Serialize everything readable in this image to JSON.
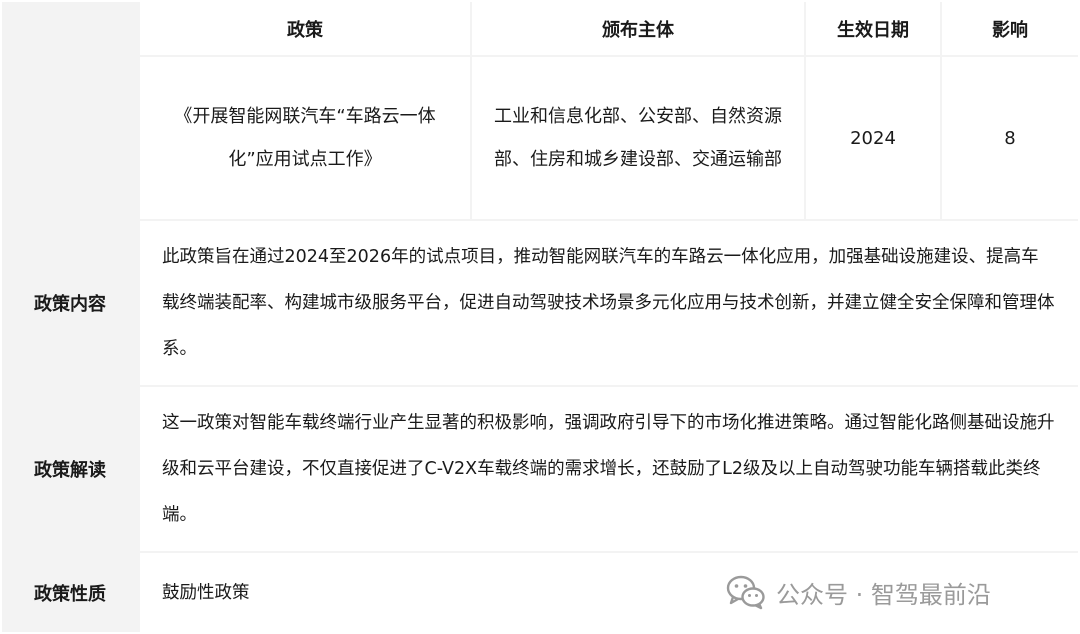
{
  "table": {
    "headers": {
      "policy": "政策",
      "issuer": "颁布主体",
      "date": "生效日期",
      "impact": "影响"
    },
    "row": {
      "policy_name": "《开展智能网联汽车“车路云一体化”应用试点工作》",
      "issuer": "工业和信息化部、公安部、自然资源部、住房和城乡建设部、交通运输部",
      "date": "2024",
      "impact": "8"
    },
    "sections": [
      {
        "label": "政策内容",
        "text": "此政策旨在通过2024至2026年的试点项目，推动智能网联汽车的车路云一体化应用，加强基础设施建设、提高车载终端装配率、构建城市级服务平台，促进自动驾驶技术场景多元化应用与技术创新，并建立健全安全保障和管理体系。"
      },
      {
        "label": "政策解读",
        "text": "这一政策对智能车载终端行业产生显著的积极影响，强调政府引导下的市场化推进策略。通过智能化路侧基础设施升级和云平台建设，不仅直接促进了C-V2X车载终端的需求增长，还鼓励了L2级及以上自动驾驶功能车辆搭载此类终端。"
      },
      {
        "label": "政策性质",
        "text": "鼓励性政策"
      }
    ]
  },
  "watermark": {
    "text": "公众号 · 智驾最前沿",
    "icon": "wechat-icon"
  }
}
